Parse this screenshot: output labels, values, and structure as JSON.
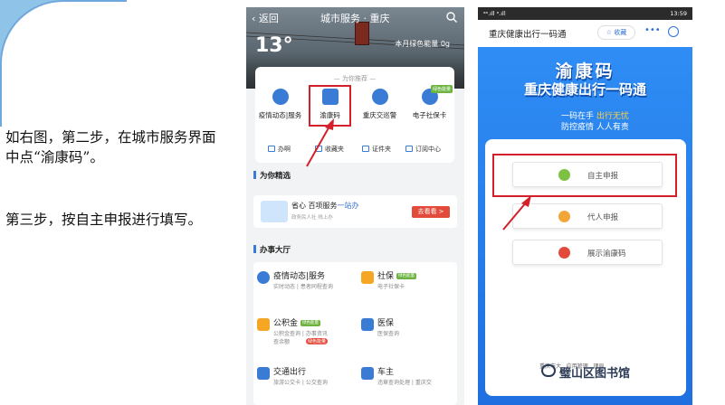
{
  "slide": {
    "step2_text": "如右图，第二步，在城市服务界面中点“渝康码”。",
    "step3_text": "第三步，按自主申报进行填写。"
  },
  "phone1": {
    "back_label": "返回",
    "title": "城市服务 · 重庆",
    "temperature": "13°",
    "energy_label": "本月绿色能量 0g",
    "recommend_title": "为你推荐",
    "recommend_items": [
      {
        "label": "疫情动态|服务",
        "icon": "virus-icon"
      },
      {
        "label": "渝康码",
        "icon": "id-card-icon"
      },
      {
        "label": "重庆交巡警",
        "icon": "police-icon"
      },
      {
        "label": "电子社保卡",
        "icon": "card-icon",
        "badge": "绿色能量"
      }
    ],
    "quick_actions": [
      "办啊",
      "收藏夹",
      "证件夹",
      "订阅中心"
    ],
    "featured_title": "为你精选",
    "banner": {
      "main_prefix": "省心 百项服务",
      "main_highlight": "一站办",
      "sub": "政务民人社 线上办",
      "button": "去看看 >"
    },
    "hall_title": "办事大厅",
    "services": [
      {
        "title": "疫情动态|服务",
        "sub": "实时动态 | 患者同程查询",
        "sub2": "",
        "badge": "",
        "color": "#3a7bd5"
      },
      {
        "title": "社保",
        "sub": "电子社保卡",
        "sub2": "",
        "badge": "绿色能量",
        "color": "#f5a623"
      },
      {
        "title": "公积金",
        "sub": "公积金查询 | 办事资讯",
        "sub2": "查余额",
        "badge": "绿色能量",
        "color": "#f5a623"
      },
      {
        "title": "医保",
        "sub": "医保查询",
        "sub2": "",
        "badge": "",
        "color": "#3a7bd5"
      },
      {
        "title": "交通出行",
        "sub": "旅游公交卡 | 公交查询",
        "sub2": "",
        "badge": "",
        "color": "#3a7bd5"
      },
      {
        "title": "车主",
        "sub": "违章查询处理 | 重庆交",
        "sub2": "",
        "badge": "",
        "color": "#3a7bd5"
      }
    ],
    "gjj_red_badge": "绿色能量"
  },
  "phone2": {
    "status_left": "ᵃᵃ.ıll ᵃ.ıll",
    "status_right": "13:59",
    "bar_title": "重庆健康出行一码通",
    "fav_label": "☆ 收藏",
    "more_label": "•••",
    "heading1": "渝康码",
    "heading2": "重庆健康出行一码通",
    "slogan1_prefix": "一码在手 ",
    "slogan1_highlight": "出行无忧",
    "slogan2": "防控疫情 人人有责",
    "buttons": [
      {
        "label": "自主申报",
        "color": "#7cc142"
      },
      {
        "label": "代人申报",
        "color": "#f2a638"
      },
      {
        "label": "展示渝康码",
        "color": "#e24b3b"
      }
    ],
    "footer": "重庆市大...应用管理...理局"
  },
  "watermark": "璧山区图书馆",
  "colors": {
    "highlight_box": "#d3202a",
    "brand_blue": "#2d7ff0"
  }
}
